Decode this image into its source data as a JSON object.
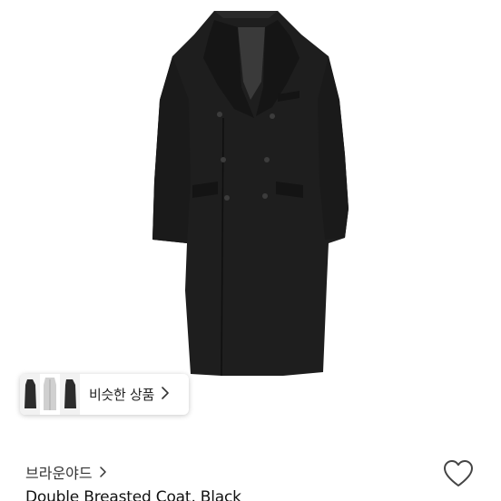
{
  "product": {
    "image_alt": "coat-photo",
    "brand": "브라운야드",
    "title": "Double Breasted Coat, Black"
  },
  "similar": {
    "label": "비슷한 상품",
    "thumbnail_colors": [
      "#2b2b2b",
      "#cfcfcf",
      "#2b2b2b"
    ]
  },
  "icons": {
    "brand_chevron": "chevron-right-icon",
    "similar_chevron": "chevron-right-icon",
    "wishlist": "heart-outline-icon"
  },
  "colors": {
    "coat": "#1e1e1e",
    "text_primary": "#111111",
    "text_secondary": "#333333"
  }
}
